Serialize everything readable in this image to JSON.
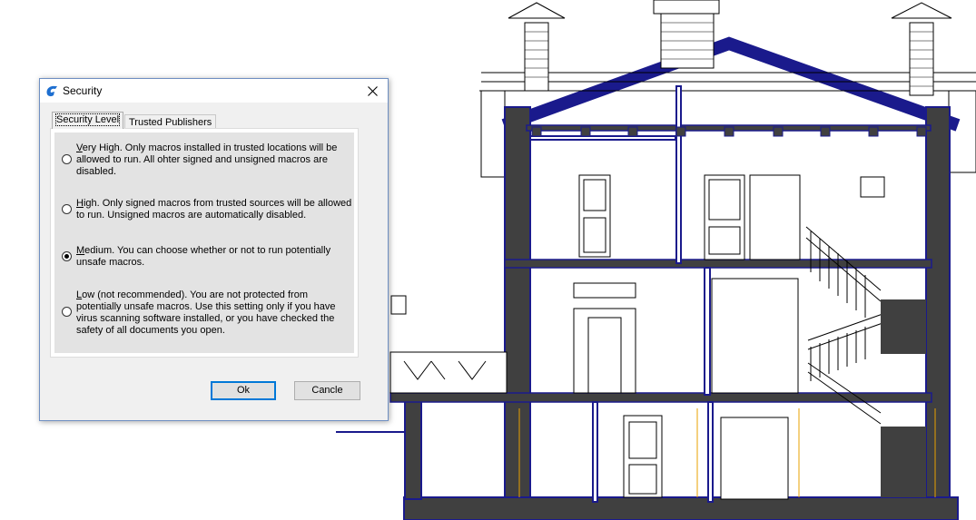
{
  "dialog": {
    "title": "Security",
    "tabs": [
      {
        "label": "Security Level",
        "active": true
      },
      {
        "label": "Trusted Publishers",
        "active": false
      }
    ],
    "options": [
      {
        "key": "V",
        "rest": "ery High. Only macros installed in trusted locations will be allowed to run. All ohter signed and unsigned macros are disabled.",
        "checked": false
      },
      {
        "key": "H",
        "rest": "igh. Only signed macros from trusted sources will be allowed to run. Unsigned macros are automatically disabled.",
        "checked": false
      },
      {
        "key": "M",
        "rest": "edium. You can choose whether or not to run potentially unsafe macros.",
        "checked": true
      },
      {
        "key": "L",
        "rest": "ow (not recommended). You are not protected from potentially unsafe macros. Use this setting only if you have virus scanning software installed, or you have checked the safety of all documents you open.",
        "checked": false
      }
    ],
    "ok_label": "Ok",
    "cancel_label": "Cancle"
  },
  "colors": {
    "accent": "#0078d7",
    "wall_fill": "#404040",
    "drawing_line": "#000000",
    "drawing_blue": "#1a1a8c",
    "marker_orange": "#e8a000",
    "app_icon_blue": "#1e6fd0"
  },
  "icons": {
    "app": "app-logo-icon",
    "close": "close-icon"
  }
}
